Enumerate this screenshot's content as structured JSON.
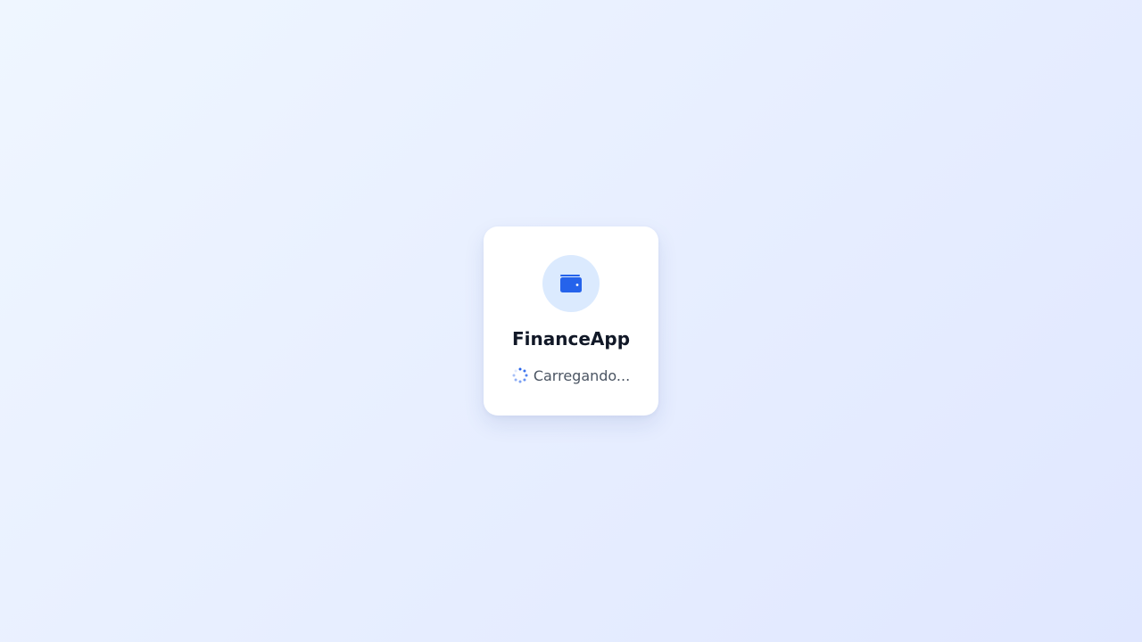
{
  "app": {
    "name": "FinanceApp",
    "loading_text": "Carregando..."
  },
  "icons": {
    "logo": "wallet-icon",
    "spinner": "spinner-icon"
  },
  "colors": {
    "accent": "#2563eb",
    "logo_bg": "#dbeafe",
    "title": "#111827",
    "muted_text": "#4b5563",
    "background_start": "#eff6ff",
    "background_end": "#e0e7ff"
  }
}
